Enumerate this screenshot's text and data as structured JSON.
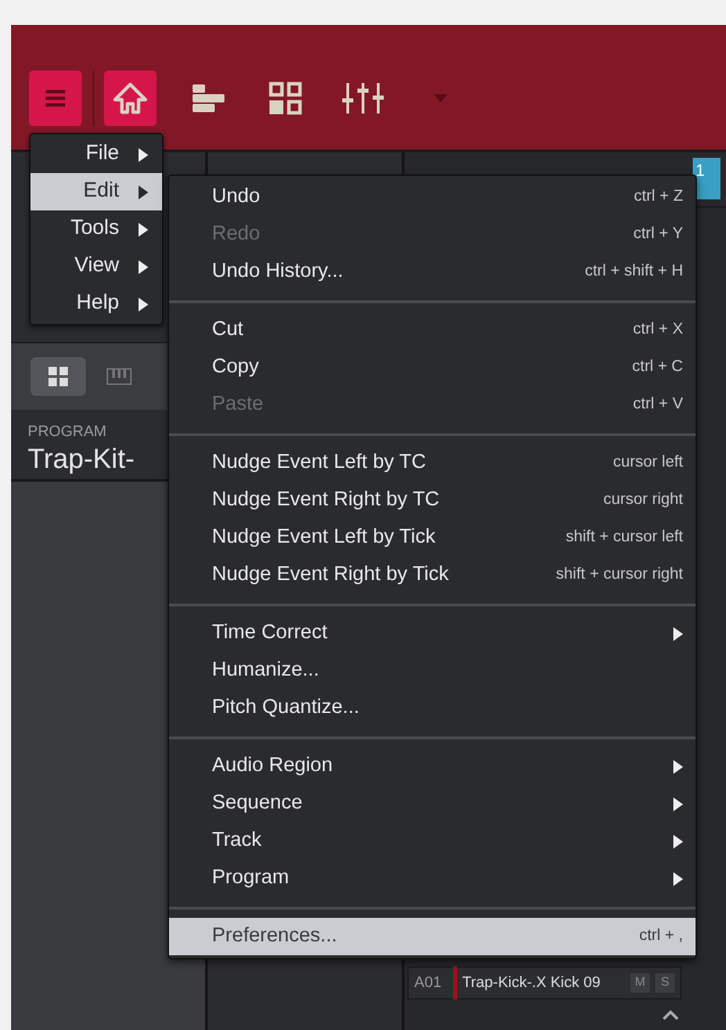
{
  "toolbar": {
    "buttons": [
      {
        "kind": "menu",
        "selected": true
      },
      {
        "kind": "home",
        "selected": true
      },
      {
        "kind": "arrange",
        "selected": false
      },
      {
        "kind": "grid",
        "selected": false
      },
      {
        "kind": "mixer",
        "selected": false
      },
      {
        "kind": "dropdown",
        "selected": false
      }
    ]
  },
  "program_panel": {
    "label": "PROGRAM",
    "name": "Trap-Kit-"
  },
  "sequence_marker": {
    "number": "1"
  },
  "track": {
    "pad": "A01",
    "name": "Trap-Kick-.X Kick 09",
    "mute": "M",
    "solo": "S"
  },
  "main_menu": [
    {
      "label": "File",
      "selected": false
    },
    {
      "label": "Edit",
      "selected": true
    },
    {
      "label": "Tools",
      "selected": false
    },
    {
      "label": "View",
      "selected": false
    },
    {
      "label": "Help",
      "selected": false
    }
  ],
  "edit_menu": [
    [
      {
        "label": "Undo",
        "shortcut": "ctrl + Z",
        "disabled": false,
        "submenu": false,
        "selected": false
      },
      {
        "label": "Redo",
        "shortcut": "ctrl + Y",
        "disabled": true,
        "submenu": false,
        "selected": false
      },
      {
        "label": "Undo History...",
        "shortcut": "ctrl + shift + H",
        "disabled": false,
        "submenu": false,
        "selected": false
      }
    ],
    [
      {
        "label": "Cut",
        "shortcut": "ctrl + X",
        "disabled": false,
        "submenu": false,
        "selected": false
      },
      {
        "label": "Copy",
        "shortcut": "ctrl + C",
        "disabled": false,
        "submenu": false,
        "selected": false
      },
      {
        "label": "Paste",
        "shortcut": "ctrl + V",
        "disabled": true,
        "submenu": false,
        "selected": false
      }
    ],
    [
      {
        "label": "Nudge Event Left by TC",
        "shortcut": "cursor left",
        "disabled": false,
        "submenu": false,
        "selected": false
      },
      {
        "label": "Nudge Event Right by TC",
        "shortcut": "cursor right",
        "disabled": false,
        "submenu": false,
        "selected": false
      },
      {
        "label": "Nudge Event Left by Tick",
        "shortcut": "shift + cursor left",
        "disabled": false,
        "submenu": false,
        "selected": false
      },
      {
        "label": "Nudge Event Right by Tick",
        "shortcut": "shift + cursor right",
        "disabled": false,
        "submenu": false,
        "selected": false
      }
    ],
    [
      {
        "label": "Time Correct",
        "disabled": false,
        "submenu": true,
        "selected": false
      },
      {
        "label": "Humanize...",
        "disabled": false,
        "submenu": false,
        "selected": false
      },
      {
        "label": "Pitch Quantize...",
        "disabled": false,
        "submenu": false,
        "selected": false
      }
    ],
    [
      {
        "label": "Audio Region",
        "disabled": false,
        "submenu": true,
        "selected": false
      },
      {
        "label": "Sequence",
        "disabled": false,
        "submenu": true,
        "selected": false
      },
      {
        "label": "Track",
        "disabled": false,
        "submenu": true,
        "selected": false
      },
      {
        "label": "Program",
        "disabled": false,
        "submenu": true,
        "selected": false
      }
    ],
    [
      {
        "label": "Preferences...",
        "shortcut": "ctrl + ,",
        "disabled": false,
        "submenu": false,
        "selected": true
      }
    ]
  ]
}
